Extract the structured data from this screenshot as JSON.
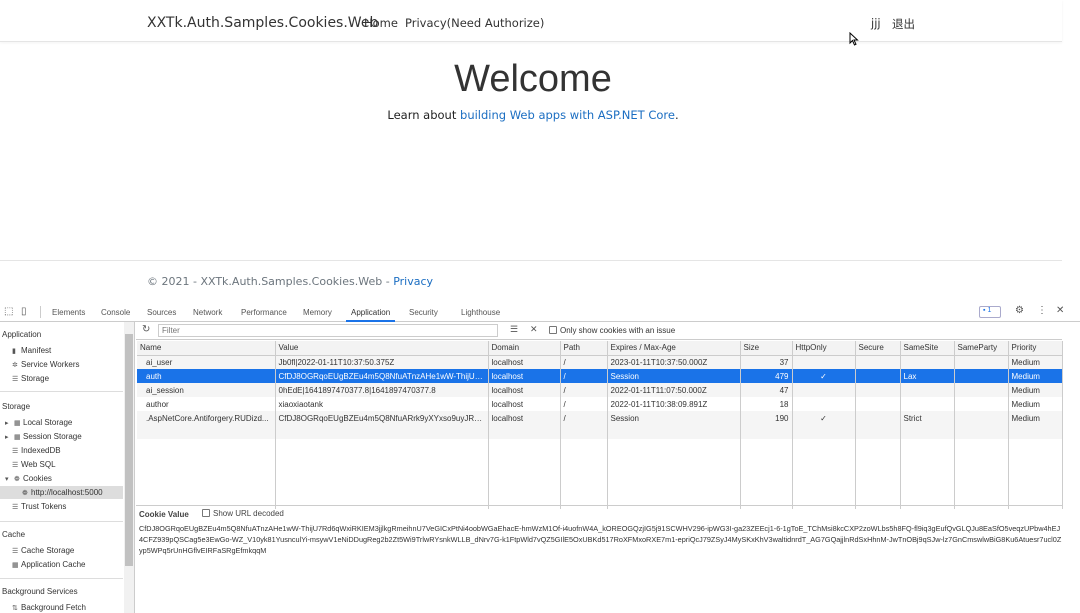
{
  "site": {
    "brand": "XXTk.Auth.Samples.Cookies.Web",
    "nav": [
      "Home",
      "Privacy(Need Authorize)"
    ],
    "user": "jjj",
    "logout": "退出",
    "title": "Welcome",
    "learn_prefix": "Learn about ",
    "learn_link": "building Web apps with ASP.NET Core",
    "learn_suffix": ".",
    "footer": "© 2021 - XXTk.Auth.Samples.Cookies.Web - ",
    "footer_link": "Privacy"
  },
  "devtools": {
    "tabs": [
      "Elements",
      "Console",
      "Sources",
      "Network",
      "Performance",
      "Memory",
      "Application",
      "Security",
      "Lighthouse"
    ],
    "active_tab": "Application",
    "issues_badge": "1",
    "sidebar": {
      "sections": [
        {
          "title": "Application",
          "items": [
            "Manifest",
            "Service Workers",
            "Storage"
          ]
        },
        {
          "title": "Storage",
          "items": [
            "Local Storage",
            "Session Storage",
            "IndexedDB",
            "Web SQL",
            "Cookies",
            "http://localhost:5000",
            "Trust Tokens"
          ]
        },
        {
          "title": "Cache",
          "items": [
            "Cache Storage",
            "Application Cache"
          ]
        },
        {
          "title": "Background Services",
          "items": [
            "Background Fetch"
          ]
        }
      ]
    },
    "filter_placeholder": "Filter",
    "only_issues_label": "Only show cookies with an issue",
    "columns": [
      "Name",
      "Value",
      "Domain",
      "Path",
      "Expires / Max-Age",
      "Size",
      "HttpOnly",
      "Secure",
      "SameSite",
      "SameParty",
      "Priority"
    ],
    "rows": [
      [
        "ai_user",
        "Jb0fl|2022-01-11T10:37:50.375Z",
        "localhost",
        "/",
        "2023-01-11T10:37:50.000Z",
        "37",
        "",
        "",
        "",
        "",
        "Medium"
      ],
      [
        "auth",
        "CfDJ8OGRqoEUgBZEu4m5Q8NfuATnzAHe1wW-ThijU7...",
        "localhost",
        "/",
        "Session",
        "479",
        "✓",
        "",
        "Lax",
        "",
        "Medium"
      ],
      [
        "ai_session",
        "0hEdE|1641897470377.8|1641897470377.8",
        "localhost",
        "/",
        "2022-01-11T11:07:50.000Z",
        "47",
        "",
        "",
        "",
        "",
        "Medium"
      ],
      [
        "author",
        "xiaoxiaotank",
        "localhost",
        "/",
        "2022-01-11T10:38:09.891Z",
        "18",
        "",
        "",
        "",
        "",
        "Medium"
      ],
      [
        ".AspNetCore.Antiforgery.RUDizd...",
        "CfDJ8OGRqoEUgBZEu4m5Q8NfuARrk9yXYxso9uyJR1F...",
        "localhost",
        "/",
        "Session",
        "190",
        "✓",
        "",
        "Strict",
        "",
        "Medium"
      ]
    ],
    "cookie_value_label": "Cookie Value",
    "show_url_decoded": "Show URL decoded",
    "cookie_value": "CfDJ8OGRqoEUgBZEu4m5Q8NfuATnzAHe1wW-ThijU7Rd6qWxiRKIEM3jjlkgRmeihnU7VeGICxPtNi4oobWGaEhacE-hmWzM1Of-i4uofnW4A_kOREOGQzjIG5j91SCWHV296-ipWG3I-ga23ZEEcj1-6-1gToE_TChMsi8kcCXP2zoWLbs5h8FQ-fl9iq3gEufQvGLQJu8EaSfO5veqzUPbw4hEJ4CFZ939pQSCag5e3EwGo-WZ_V10yk81YusnculYi-msywV1eNiDDugReg2b2Zt5Wi9TrlwRYsnkWLLB_dNrv7G-k1FtpWld7vQZ5GIlE5OxUBKd517RoXFMxoRXE7m1-epriQcJ79ZSyJ4MySKxKhV3waltidnrdT_AG7GQajjlnRdSxHhnM-JwTnOBj9qSJw-lz7GnCmswlwBiG8Ku6Atuesr7ucl0Zyp5WPq5rUnHGflvEIRFaSRgEfmkqqM"
  }
}
